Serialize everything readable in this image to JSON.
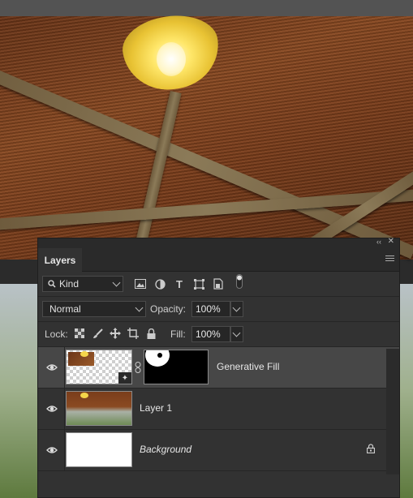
{
  "panel": {
    "tab_label": "Layers",
    "collapse_glyph": "‹‹",
    "close_glyph": "✕",
    "filter": {
      "kind_label": "Kind",
      "icons": [
        "image-filter-icon",
        "adjustment-filter-icon",
        "type-filter-icon",
        "shape-filter-icon",
        "smart-object-filter-icon",
        "filter-toggle-icon"
      ]
    },
    "blend_mode": "Normal",
    "opacity_label": "Opacity:",
    "opacity_value": "100%",
    "lock_label": "Lock:",
    "fill_label": "Fill:",
    "fill_value": "100%",
    "layers": [
      {
        "name": "Generative Fill",
        "selected": true,
        "has_mask": true,
        "italic": false,
        "locked": false
      },
      {
        "name": "Layer 1",
        "selected": false,
        "has_mask": false,
        "italic": false,
        "locked": false
      },
      {
        "name": "Background",
        "selected": false,
        "has_mask": false,
        "italic": true,
        "locked": true
      }
    ]
  }
}
